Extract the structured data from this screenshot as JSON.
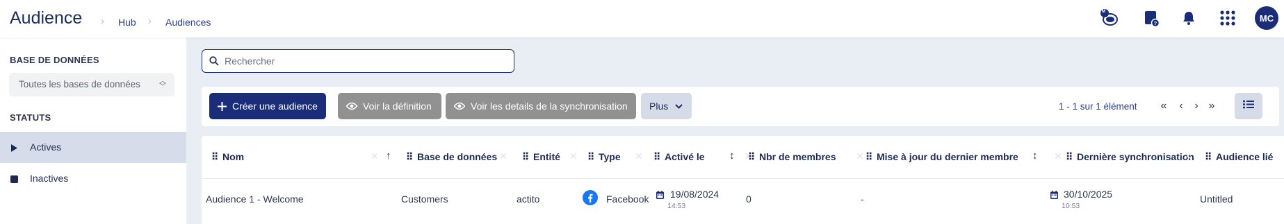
{
  "header": {
    "title": "Audience",
    "breadcrumb": [
      "Hub",
      "Audiences"
    ],
    "icons": [
      "account-switch-icon",
      "help-document-icon",
      "notification-bell-icon",
      "apps-grid-icon"
    ],
    "notif_badge": "M",
    "avatar_initials": "MC",
    "brand_color": "#1b2d78"
  },
  "sidebar": {
    "database_heading": "BASE DE DONNÉES",
    "database_select_value": "Toutes les bases de données",
    "status_heading": "STATUTS",
    "items": [
      {
        "label": "Actives",
        "icon": "play-icon",
        "active": true
      },
      {
        "label": "Inactives",
        "icon": "stop-square-icon",
        "active": false
      }
    ]
  },
  "search": {
    "placeholder": "Rechercher",
    "value": ""
  },
  "toolbar": {
    "create_label": "Créer une audience",
    "view_definition_label": "Voir la définition",
    "view_sync_label": "Voir les details de la synchronisation",
    "more_label": "Plus",
    "pagination_text": "1 - 1 sur 1 élément"
  },
  "table": {
    "columns": [
      "Nom",
      "Base de données",
      "Entité",
      "Type",
      "Activé le",
      "Nbr de membres",
      "Mise à jour du dernier membre",
      "Dernière synchronisation",
      "Audience lié"
    ],
    "rows": [
      {
        "name": "Audience 1 - Welcome",
        "database": "Customers",
        "entity": "actito",
        "type": "Facebook",
        "activated_date": "19/08/2024",
        "activated_time": "14:53",
        "members": "0",
        "last_member_update": "-",
        "last_sync_date": "30/10/2025",
        "last_sync_time": "10:53",
        "linked_audience": "Untitled"
      }
    ]
  }
}
